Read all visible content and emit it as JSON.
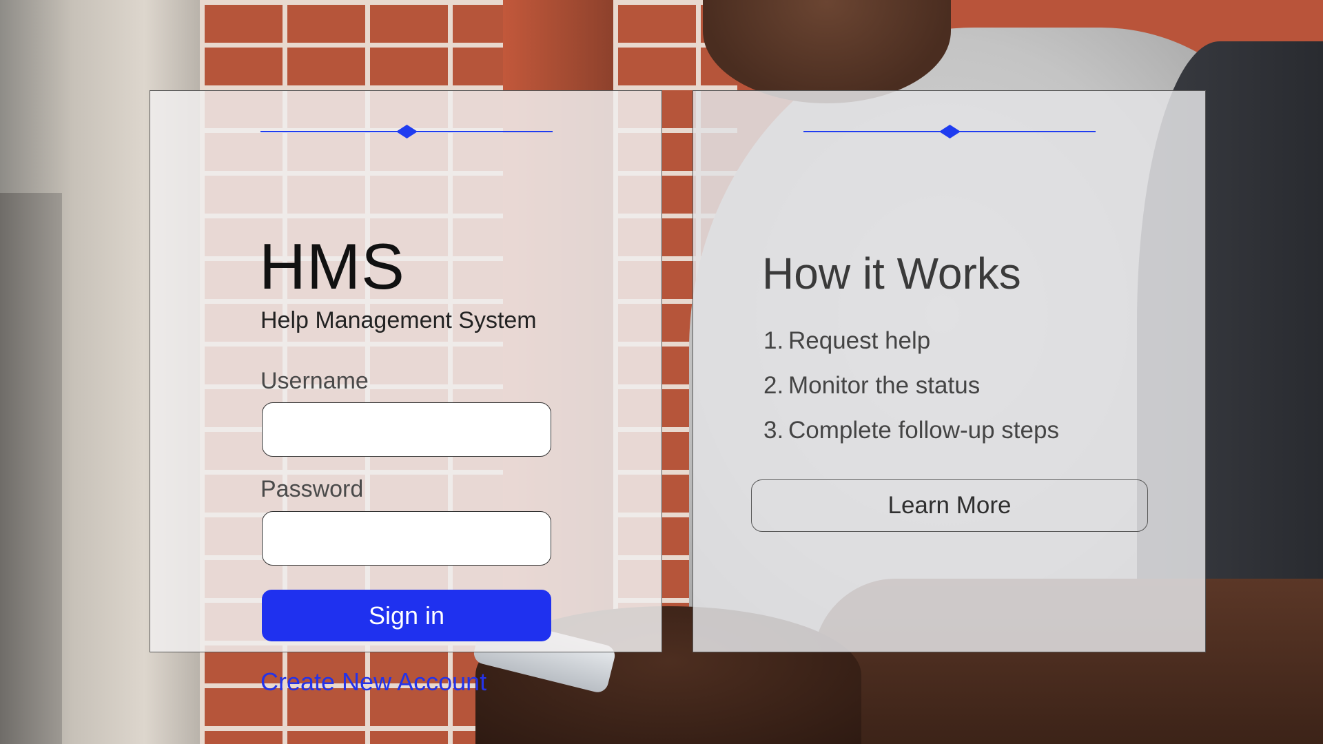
{
  "login": {
    "title": "HMS",
    "subtitle": "Help Management System",
    "username_label": "Username",
    "username_value": "",
    "password_label": "Password",
    "password_value": "",
    "signin_label": "Sign in",
    "create_account_label": "Create New Account"
  },
  "info": {
    "title": "How it Works",
    "steps": [
      {
        "number": "1.",
        "text": "Request help"
      },
      {
        "number": "2.",
        "text": "Monitor the status"
      },
      {
        "number": "3.",
        "text": "Complete follow-up steps"
      }
    ],
    "learn_more_label": "Learn More"
  },
  "colors": {
    "accent": "#1f31ef",
    "link": "#2433e8"
  }
}
